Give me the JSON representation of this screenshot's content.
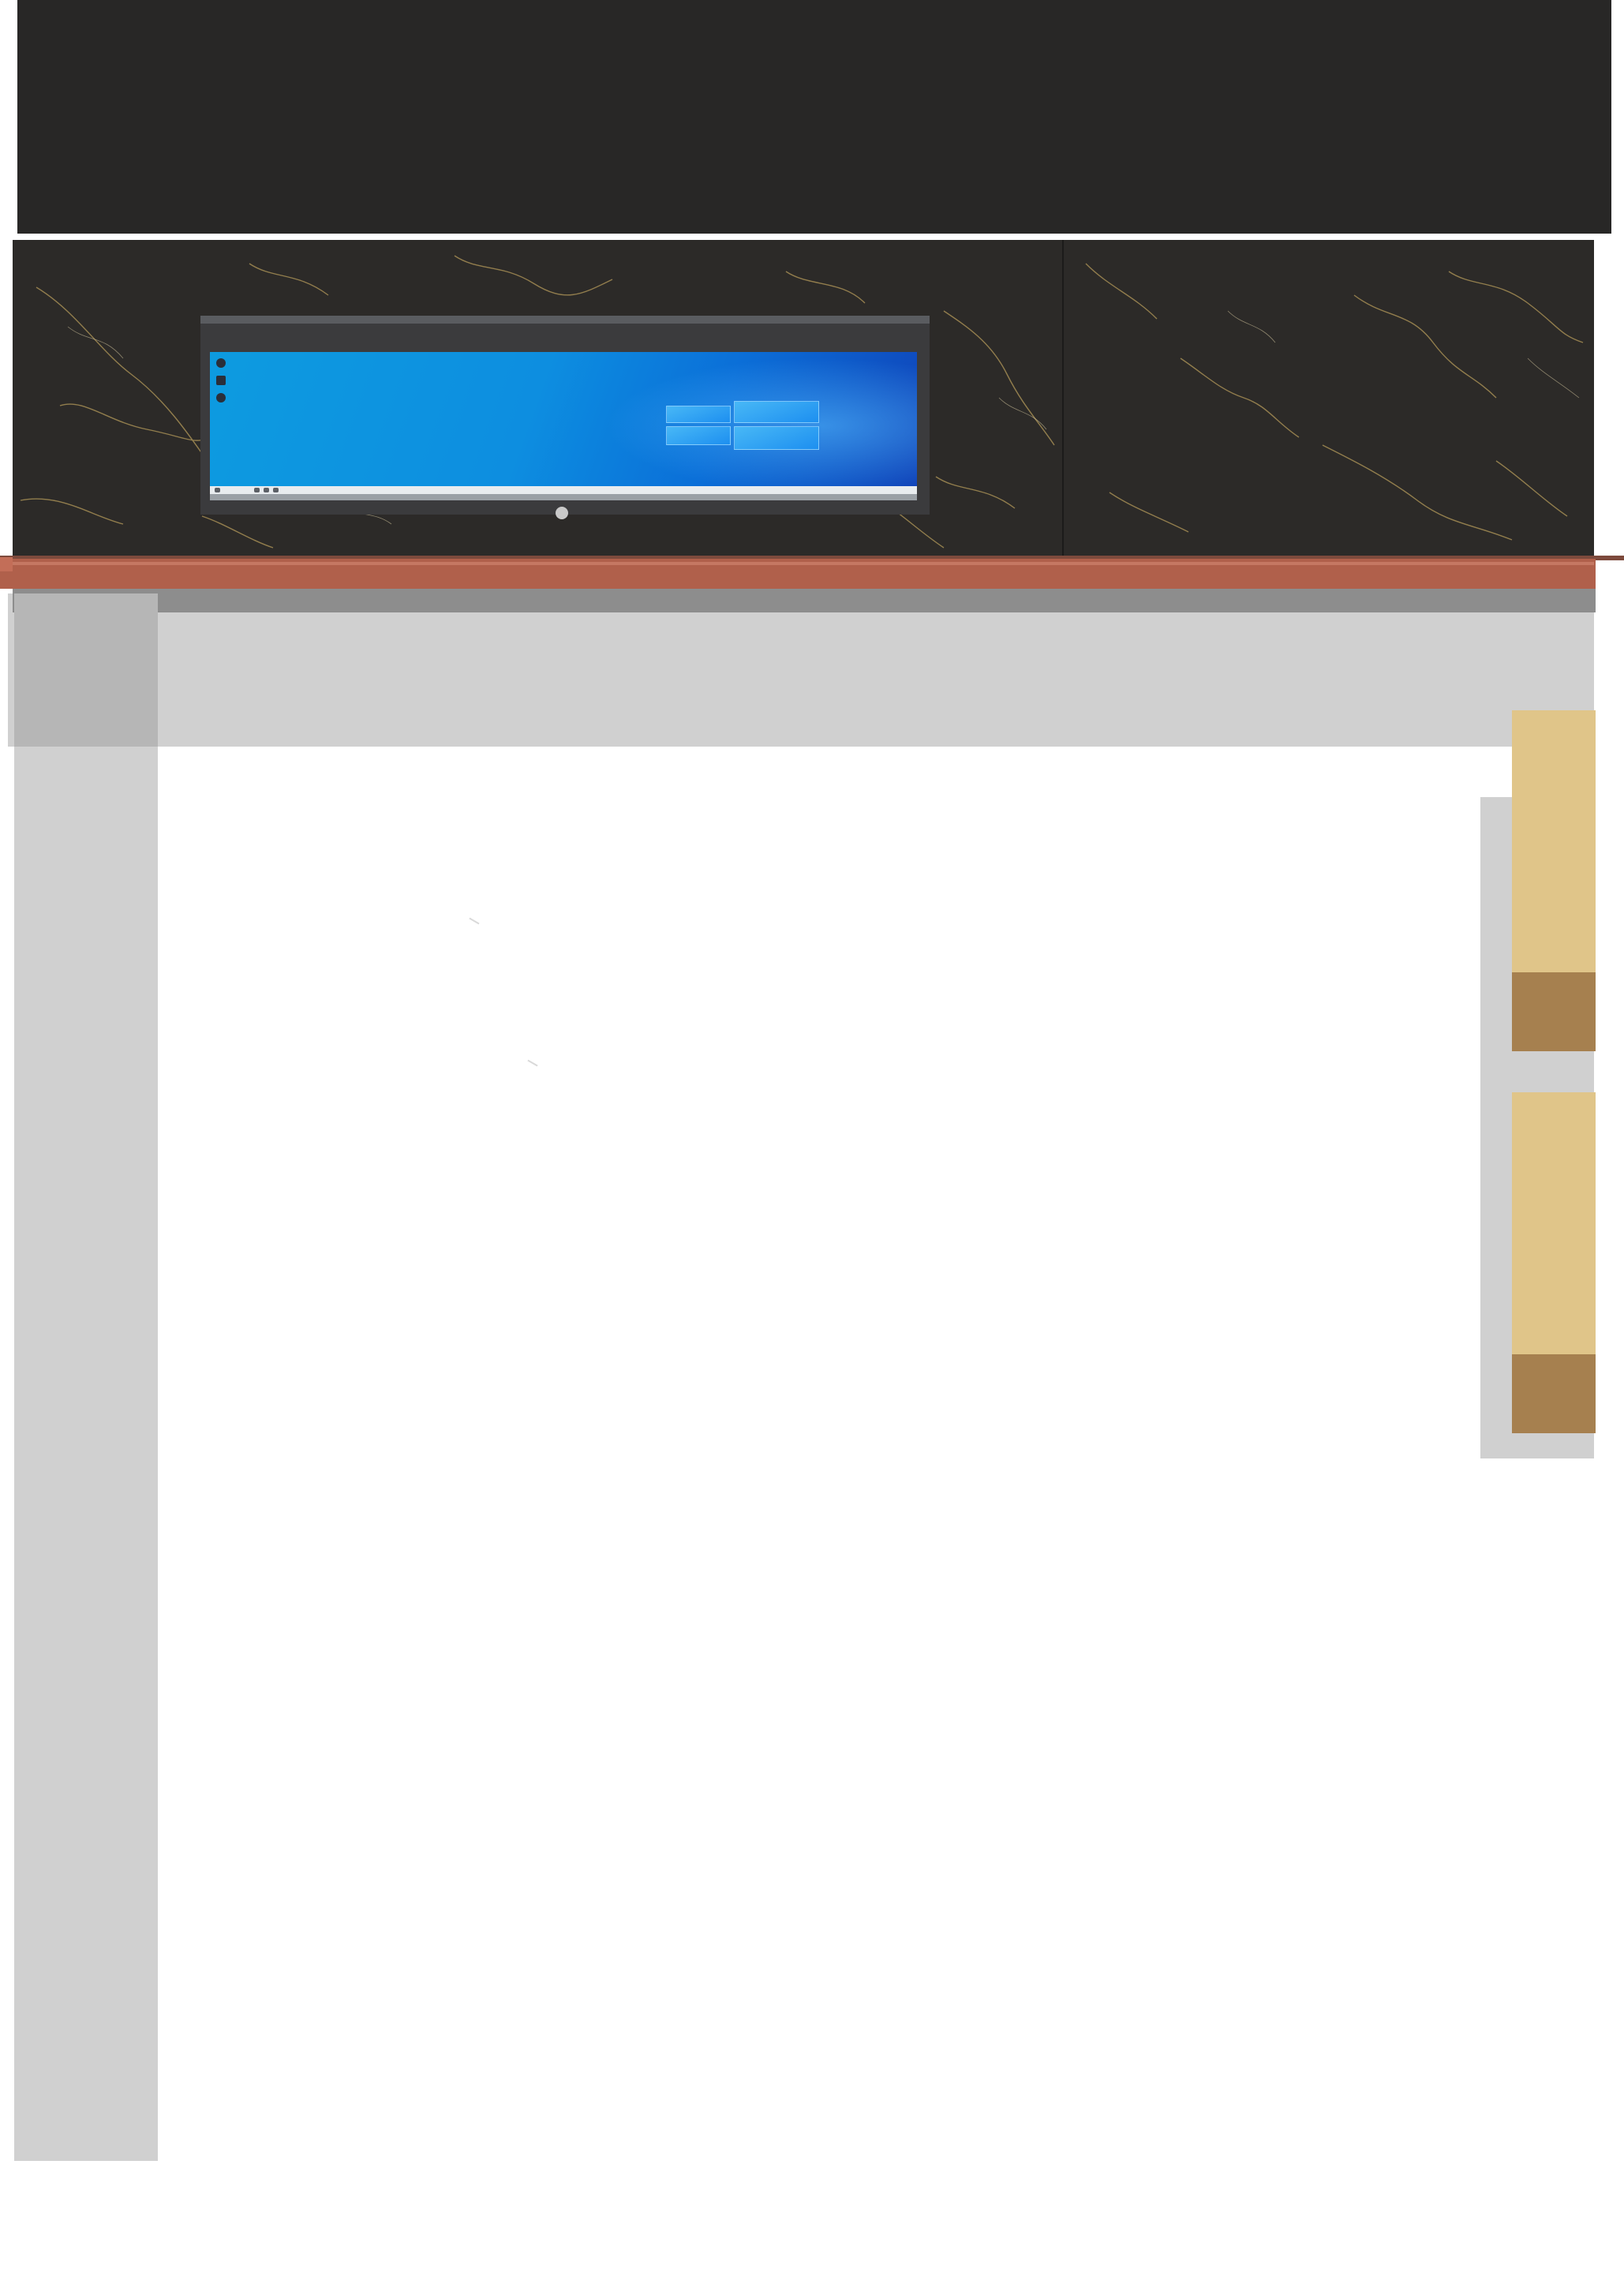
{
  "scene": {
    "description_visible_text": ""
  },
  "colors": {
    "header_band": "#282726",
    "marble": "#2c2a28",
    "marble_vein": "#b49a5a",
    "monitor_frame": "#3b3b3d",
    "screen_blue": "#0d8ee0",
    "shelf_copper": "#b0604b",
    "counter_grey": "#d0d0d0",
    "drawer_light": "#e0c589",
    "drawer_dark": "#a6804f"
  },
  "icons": {
    "windows_logo": "windows-logo-icon",
    "power_button": "power-button-icon",
    "desktop_icons": [
      "desktop-icon",
      "desktop-icon",
      "desktop-icon"
    ]
  }
}
